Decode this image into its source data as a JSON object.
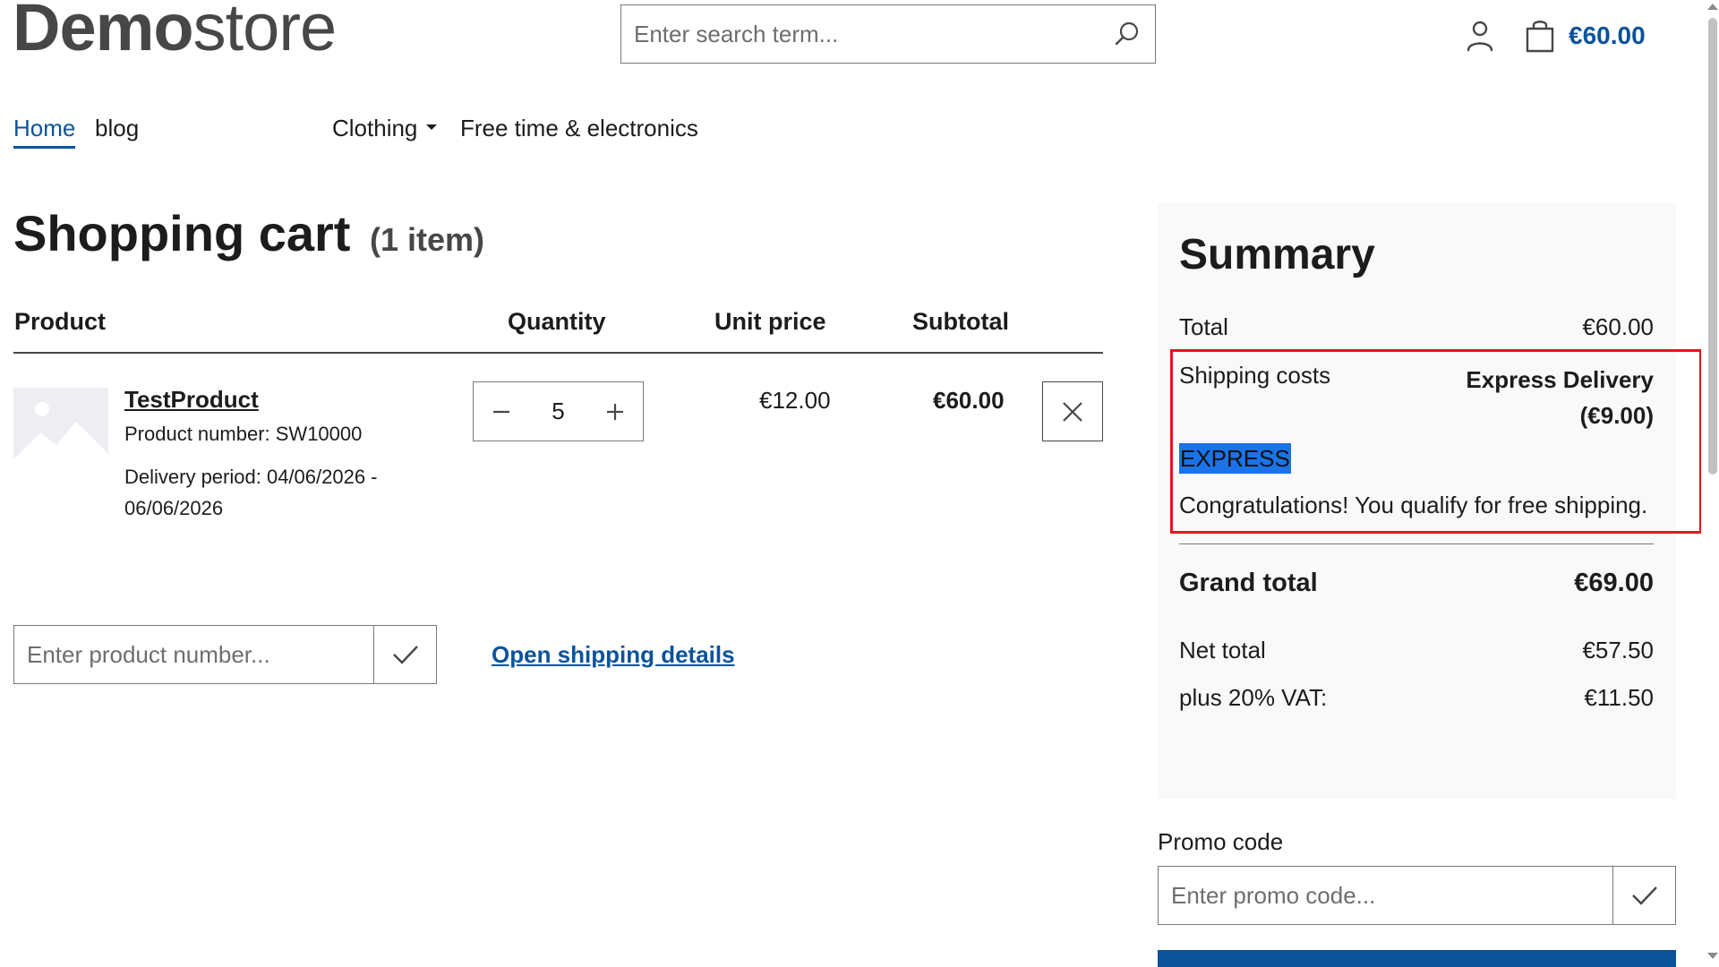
{
  "header": {
    "logo_bold": "Demo",
    "logo_light": "store",
    "search_placeholder": "Enter search term...",
    "cart_total": "€60.00"
  },
  "nav": {
    "items": [
      {
        "label": "Home",
        "active": true
      },
      {
        "label": "blog"
      },
      {
        "label": "Clothing",
        "has_dropdown": true
      },
      {
        "label": "Free time & electronics"
      }
    ]
  },
  "cart": {
    "title": "Shopping cart",
    "item_count": "(1 item)",
    "columns": {
      "product": "Product",
      "quantity": "Quantity",
      "unit_price": "Unit price",
      "subtotal": "Subtotal"
    },
    "items": [
      {
        "name": "TestProduct",
        "product_number": "Product number: SW10000",
        "delivery_line1": "Delivery period: 04/06/2026 -",
        "delivery_line2": "06/06/2026",
        "quantity": "5",
        "unit_price": "€12.00",
        "subtotal": "€60.00"
      }
    ],
    "add_product_placeholder": "Enter product number...",
    "shipping_link": "Open shipping details"
  },
  "summary": {
    "title": "Summary",
    "total_label": "Total",
    "total_value": "€60.00",
    "shipping_label": "Shipping costs",
    "shipping_value_line1": "Express Delivery",
    "shipping_value_line2": "(€9.00)",
    "shipping_tag": "EXPRESS",
    "free_shipping_note": "Congratulations! You qualify for free shipping.",
    "grand_total_label": "Grand total",
    "grand_total_value": "€69.00",
    "net_total_label": "Net total",
    "net_total_value": "€57.50",
    "vat_label": "plus 20% VAT:",
    "vat_value": "€11.50"
  },
  "promo": {
    "label": "Promo code",
    "placeholder": "Enter promo code..."
  },
  "colors": {
    "brand_blue": "#0b539b",
    "highlight_red": "#e8141c",
    "selection_blue": "#1a73e8",
    "summary_bg": "#f9f9f9"
  }
}
